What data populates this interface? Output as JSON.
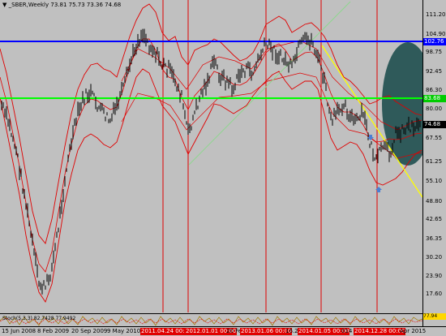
{
  "chart": {
    "menu_icon": "triangle-down-icon",
    "symbol": "_SBER,Weekly",
    "ohlc": "73.81 75.73 73.36 74.68",
    "oscillator_label": "Stoch(5,3,3) 82.7428 77.9492",
    "current_price": "74.68",
    "oscillator_value": "77.94",
    "colors": {
      "background": "#c0c0c0",
      "bars": "#000000",
      "bands": "#e00000",
      "blue_line": "#0000ff",
      "green_line": "#00ff00",
      "yellow_line": "#ffff00",
      "vertical_lines": "#e00000",
      "ellipse": "#1f4f4f",
      "trend_green": "#8fd68f"
    }
  },
  "price_axis": {
    "ticks": [
      "111.20",
      "104.90",
      "98.75",
      "92.45",
      "86.30",
      "80.00",
      "73.85",
      "67.55",
      "61.25",
      "55.10",
      "48.80",
      "42.65",
      "36.35",
      "30.20",
      "23.90",
      "17.60"
    ],
    "tags": [
      {
        "label": "102.76",
        "color": "#0000ff"
      },
      {
        "label": "83.68",
        "color": "#00cc00"
      },
      {
        "label": "74.68",
        "color": "#000000"
      }
    ]
  },
  "time_axis": {
    "labels": [
      "15 Jun 2008",
      "8 Feb 2009",
      "20 Sep 2009",
      "9 May 2010",
      "20 Fe",
      "16.2",
      "014",
      "Apr 2015"
    ],
    "tags": [
      "2011.04.24 00:00",
      "2012.01.01 00:00",
      "2013.01.06 00:00",
      "2014.01.05 00:00",
      "2014.12.28 00:00"
    ]
  }
}
